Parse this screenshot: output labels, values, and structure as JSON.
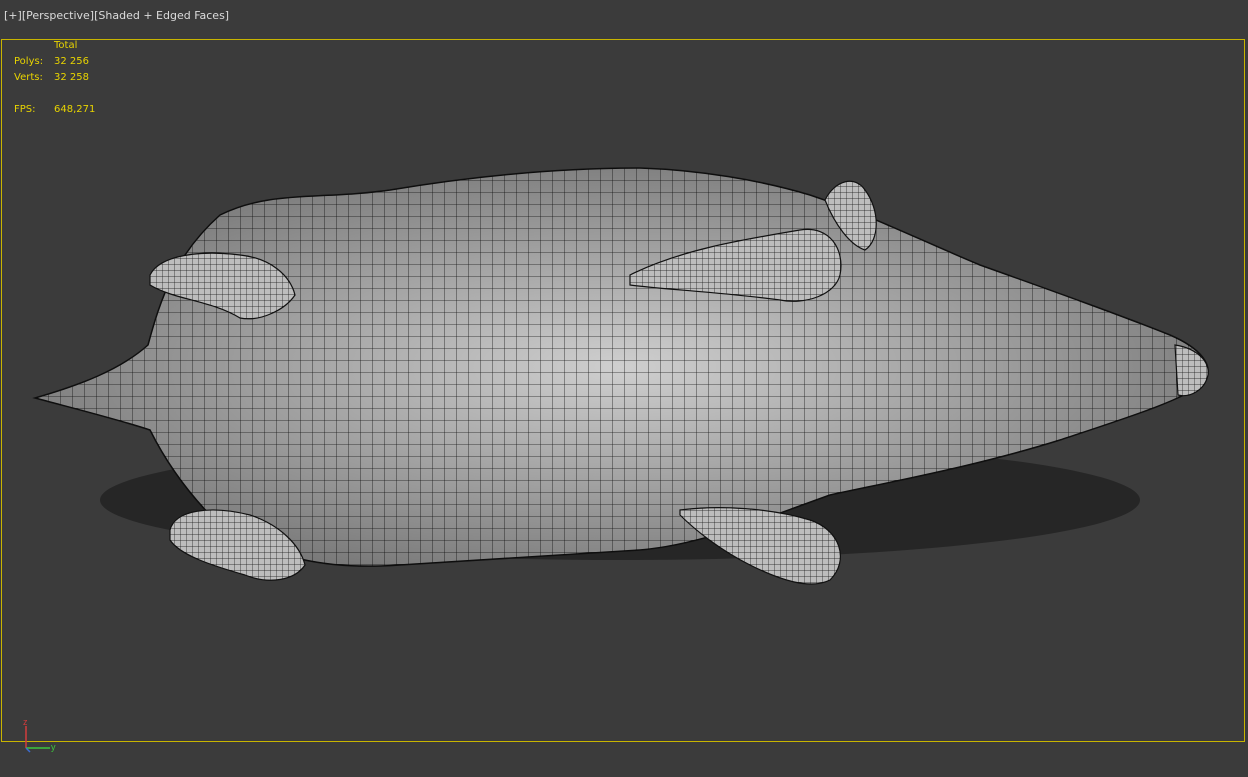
{
  "viewport": {
    "labels": {
      "plus": "[+]",
      "view": "[Perspective]",
      "shading": "[Shaded + Edged Faces]"
    },
    "stats": {
      "header": "Total",
      "polys_label": "Polys:",
      "polys_value": "32 256",
      "verts_label": "Verts:",
      "verts_value": "32 258",
      "fps_label": "FPS:",
      "fps_value": "648,271"
    },
    "axis": {
      "z": "z",
      "y": "y"
    },
    "colors": {
      "background": "#3b3b3b",
      "frame": "#c8b400",
      "stats_text": "#e8d400",
      "mesh_fill": "#cfcfcf",
      "mesh_edges": "#1a1a1a"
    }
  }
}
